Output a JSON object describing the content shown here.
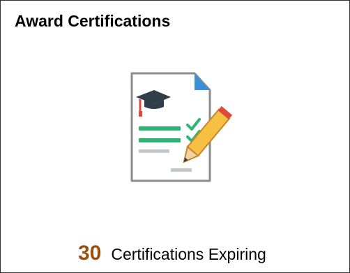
{
  "tile": {
    "title": "Award Certifications",
    "icon": "certificate-document-pencil-icon",
    "count": "30",
    "count_label": "Certifications Expiring"
  },
  "colors": {
    "count": "#9a4f12",
    "check": "#2bb673",
    "document_border": "#8c8c8c",
    "page_corner": "#3b8fd6",
    "mortarboard": "#2f3e4a",
    "tassel": "#e0483a",
    "pencil_body": "#f6c143",
    "pencil_tip": "#f3d4a0"
  }
}
